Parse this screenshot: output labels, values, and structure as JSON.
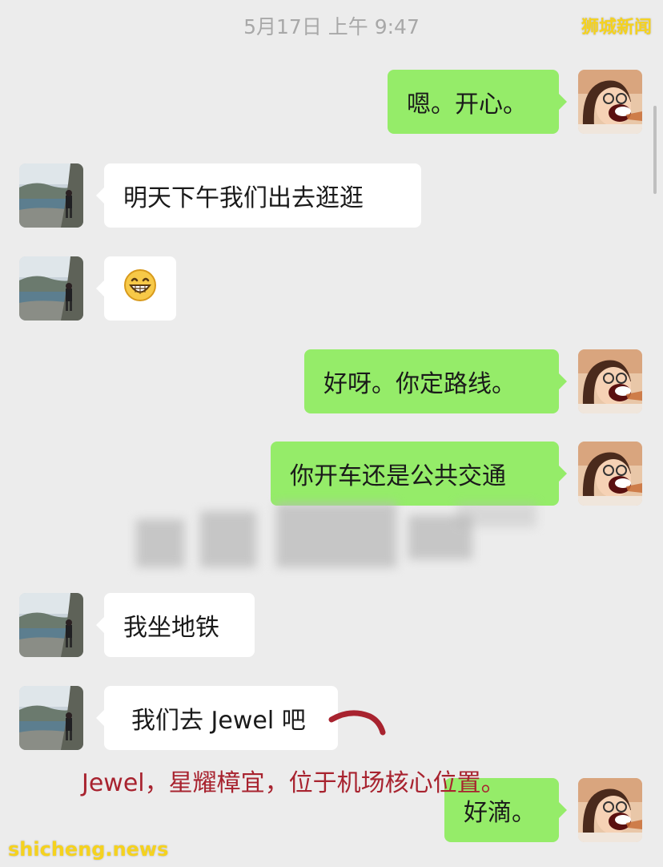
{
  "header": {
    "timestamp": "5月17日 上午 9:47",
    "watermark": "狮城新闻"
  },
  "messages": [
    {
      "side": "sent",
      "text": "嗯。开心。"
    },
    {
      "side": "received",
      "text": "明天下午我们出去逛逛"
    },
    {
      "side": "received",
      "emoji": "grinning-face-icon"
    },
    {
      "side": "sent",
      "text": "好呀。你定路线。"
    },
    {
      "side": "sent",
      "text": "你开车还是公共交通"
    },
    {
      "side": "received",
      "text": "我坐地铁"
    },
    {
      "side": "received",
      "text": "我们去 Jewel 吧"
    },
    {
      "side": "sent",
      "text": "好滴。"
    }
  ],
  "annotation": {
    "text": "Jewel，星耀樟宜，位于机场核心位置。",
    "color": "#a8232f"
  },
  "footer": {
    "watermark": "shicheng.news"
  },
  "colors": {
    "sent_bubble": "#95ec69",
    "received_bubble": "#ffffff",
    "background": "#ececec"
  }
}
